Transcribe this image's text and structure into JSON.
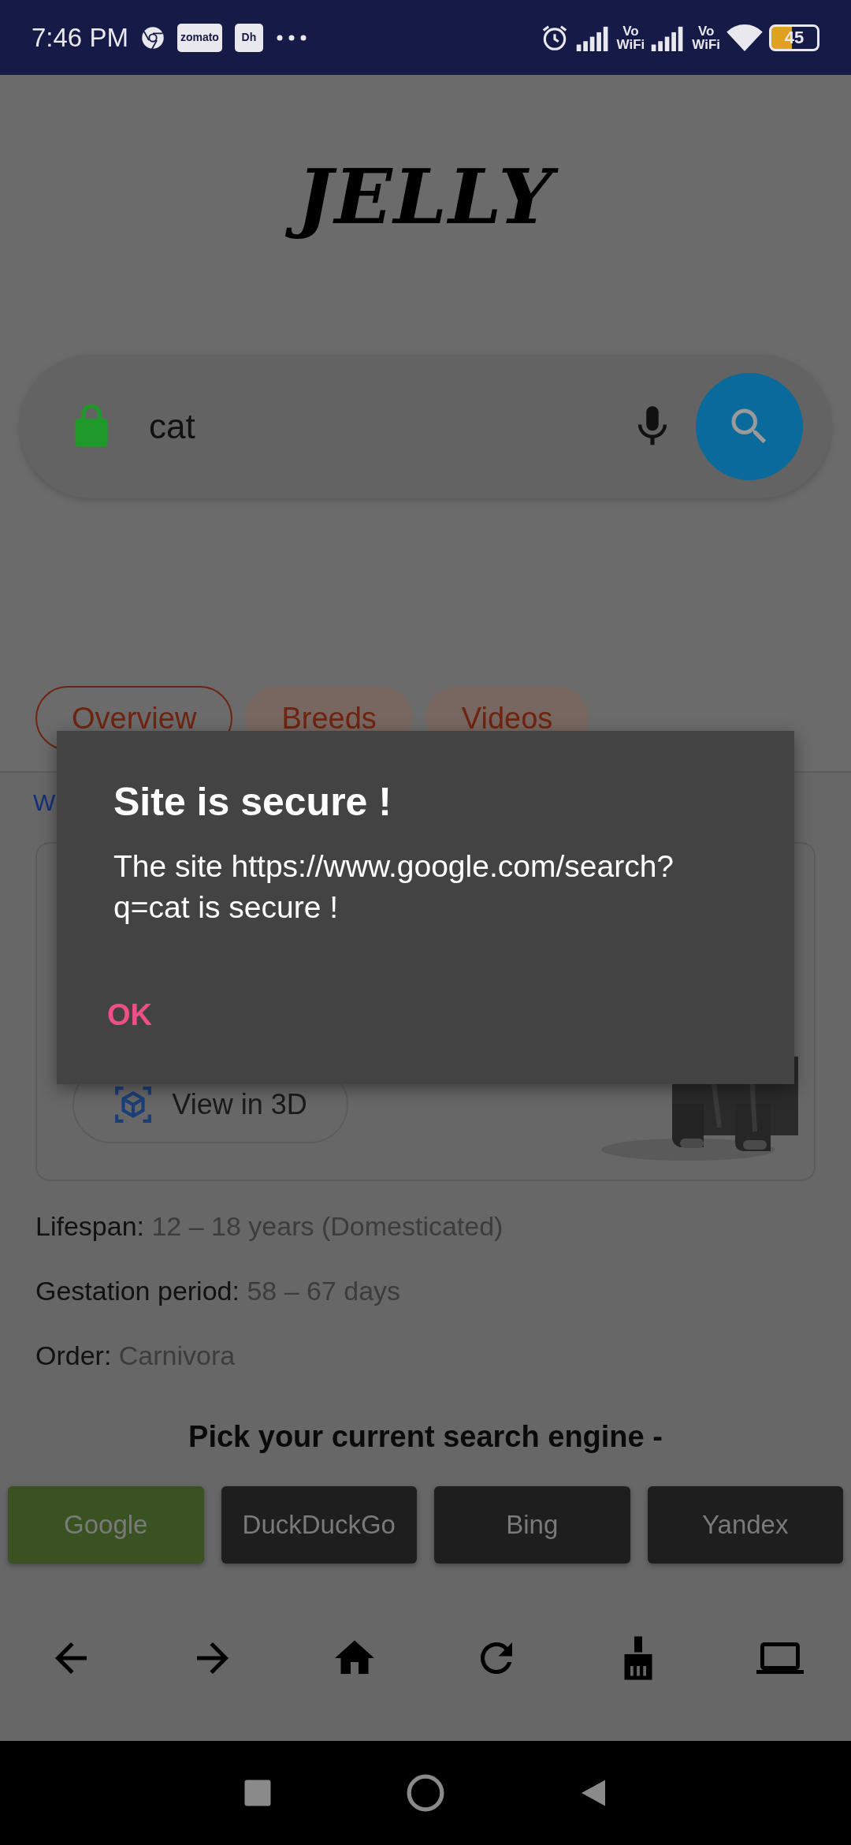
{
  "status_bar": {
    "time": "7:46 PM",
    "notification_apps": [
      {
        "kind": "chrome"
      },
      {
        "kind": "label",
        "text": "zomato"
      },
      {
        "kind": "label",
        "text": "Dh"
      }
    ],
    "networks": [
      {
        "top": "Vo",
        "bottom": "WiFi"
      },
      {
        "top": "Vo",
        "bottom": "WiFi"
      }
    ],
    "battery": "45"
  },
  "logo": "JELLY",
  "search": {
    "value": "cat"
  },
  "tabs": [
    {
      "label": "Overview",
      "selected": true
    },
    {
      "label": "Breeds",
      "selected": false
    },
    {
      "label": "Videos",
      "selected": false
    }
  ],
  "partial_link": "W",
  "card": {
    "button": "View in 3D"
  },
  "facts": [
    {
      "label": "Lifespan:",
      "value": "12 – 18 years (Domesticated)"
    },
    {
      "label": "Gestation period:",
      "value": "58 – 67 days"
    },
    {
      "label": "Order:",
      "value": "Carnivora"
    }
  ],
  "engine_prompt": "Pick your current search engine -",
  "engines": [
    {
      "label": "Google",
      "selected": true
    },
    {
      "label": "DuckDuckGo",
      "selected": false
    },
    {
      "label": "Bing",
      "selected": false
    },
    {
      "label": "Yandex",
      "selected": false
    }
  ],
  "dialog": {
    "title": "Site is secure !",
    "message": "The site https://www.google.com/search?q=cat is secure !",
    "button": "OK"
  }
}
